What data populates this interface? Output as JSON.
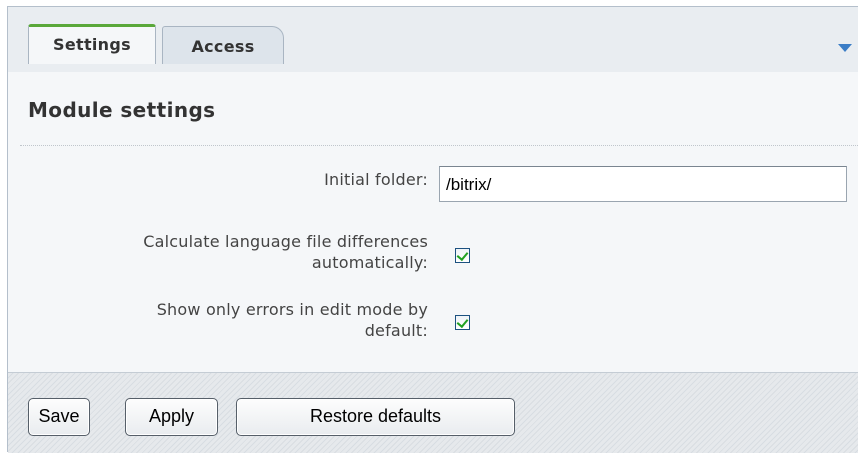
{
  "tabs": [
    {
      "label": "Settings",
      "active": true
    },
    {
      "label": "Access",
      "active": false
    }
  ],
  "section": {
    "title": "Module settings"
  },
  "fields": {
    "initial_folder": {
      "label": "Initial folder:",
      "value": "/bitrix/"
    },
    "calc_diff": {
      "label_line1": "Calculate language file differences",
      "label_line2": "automatically:",
      "checked": true
    },
    "show_errors": {
      "label_line1": "Show only errors in edit mode by",
      "label_line2": "default:",
      "checked": true
    }
  },
  "buttons": {
    "save": "Save",
    "apply": "Apply",
    "restore": "Restore defaults"
  },
  "colors": {
    "active_tab_accent": "#5aa83a",
    "dropdown_arrow": "#3b7dc6",
    "checkmark": "#21a121"
  }
}
